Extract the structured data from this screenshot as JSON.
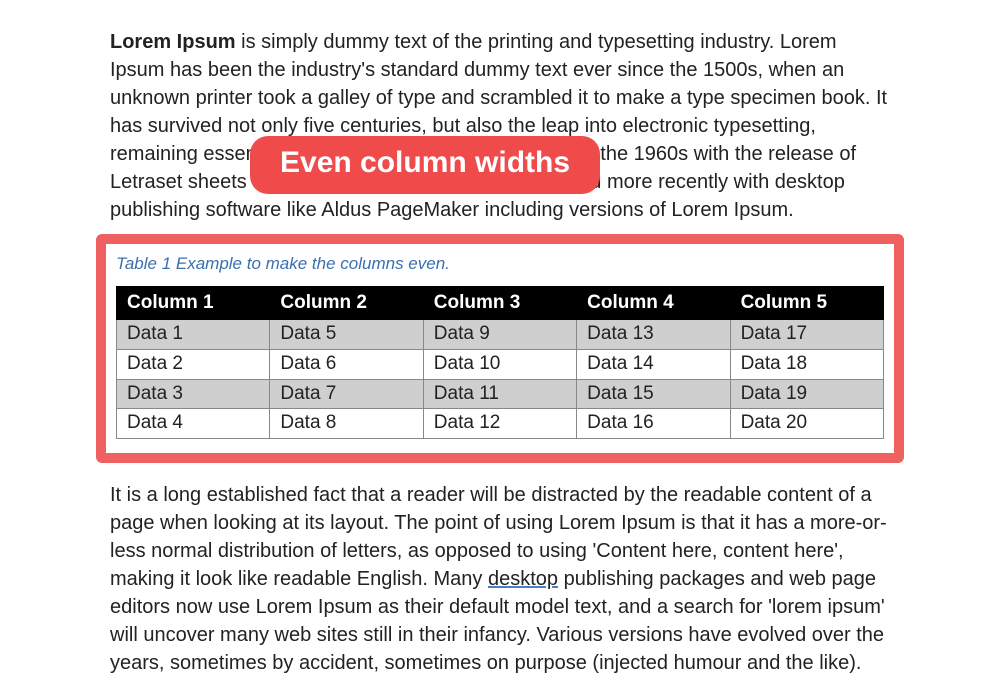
{
  "callout_label": "Even column widths",
  "para1": {
    "bold_lead": "Lorem Ipsum",
    "rest": " is simply dummy text of the printing and typesetting industry. Lorem Ipsum has been the industry's standard dummy text ever since the 1500s, when an unknown printer took a galley of type and scrambled it to make a type specimen book. It has survived not only five centuries, but also the leap into electronic typesetting, remaining essentially unchanged. It was popularised in the 1960s with the release of Letraset sheets containing Lorem Ipsum passages, and more recently with desktop publishing software like Aldus PageMaker including versions of Lorem Ipsum."
  },
  "table_caption": "Table 1 Example to make the columns even.",
  "table": {
    "headers": [
      "Column 1",
      "Column 2",
      "Column 3",
      "Column 4",
      "Column 5"
    ],
    "rows": [
      [
        "Data 1",
        "Data 5",
        "Data 9",
        "Data 13",
        "Data 17"
      ],
      [
        "Data 2",
        "Data 6",
        "Data 10",
        "Data 14",
        "Data 18"
      ],
      [
        "Data 3",
        "Data 7",
        "Data 11",
        "Data 15",
        "Data 19"
      ],
      [
        "Data 4",
        "Data 8",
        "Data 12",
        "Data 16",
        "Data 20"
      ]
    ]
  },
  "para2": {
    "part1": "It is a long established fact that a reader will be distracted by the readable content of a page when looking at its layout. The point of using Lorem Ipsum is that it has a more-or-less normal distribution of letters, as opposed to using 'Content here, content here', making it look like readable English. Many ",
    "underlined": "desktop",
    "part2": " publishing packages and web page editors now use Lorem Ipsum as their default model text, and a search for 'lorem ipsum' will uncover many web sites still in their infancy. Various versions have evolved over the years, sometimes by accident, sometimes on purpose (injected humour and the like)."
  }
}
